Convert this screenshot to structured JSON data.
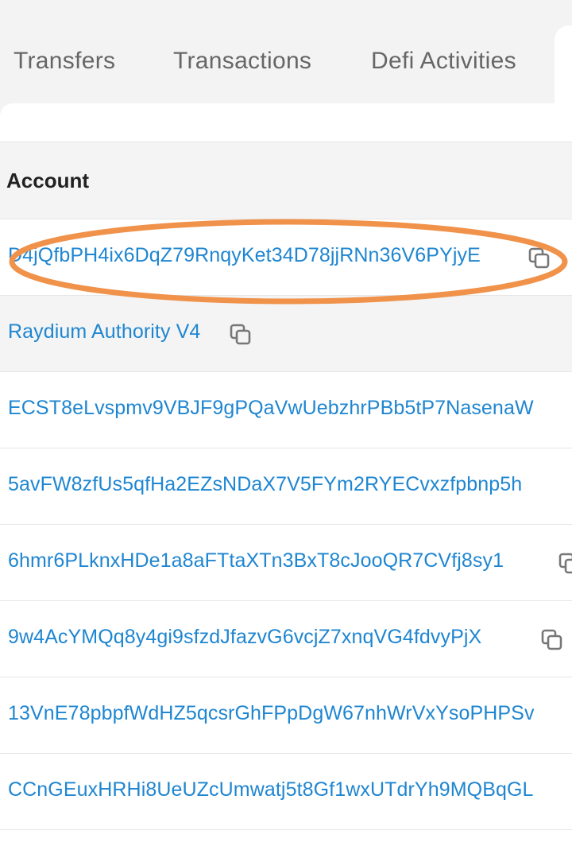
{
  "tabs": [
    {
      "label": "Transfers"
    },
    {
      "label": "Transactions"
    },
    {
      "label": "Defi Activities"
    }
  ],
  "table": {
    "header": "Account",
    "rows": [
      {
        "account": "D4jQfbPH4ix6DqZ79RnqyKet34D78jjRNn36V6PYjyE",
        "copyable": true,
        "highlighted": true
      },
      {
        "account": "Raydium Authority V4",
        "copyable": true
      },
      {
        "account": "ECST8eLvspmv9VBJF9gPQaVwUebzhrPBb5tP7NasenaW",
        "copyable": false
      },
      {
        "account": "5avFW8zfUs5qfHa2EZsNDaX7V5FYm2RYECvxzfpbnp5h",
        "copyable": false
      },
      {
        "account": "6hmr6PLknxHDe1a8aFTtaXTn3BxT8cJooQR7CVfj8sy1",
        "copyable": true
      },
      {
        "account": "9w4AcYMQq8y4gi9sfzdJfazvG6vcjZ7xnqVG4fdvyPjX",
        "copyable": true
      },
      {
        "account": "13VnE78pbpfWdHZ5qcsrGhFPpDgW67nhWrVxYsoPHPSv",
        "copyable": false
      },
      {
        "account": "CCnGEuxHRHi8UeUZcUmwatj5t8Gf1wxUTdrYh9MQBqGL",
        "copyable": false
      }
    ]
  },
  "colors": {
    "link": "#1f86d1",
    "annotation": "#f0924a"
  },
  "icons": {
    "copy": "copy-icon"
  }
}
